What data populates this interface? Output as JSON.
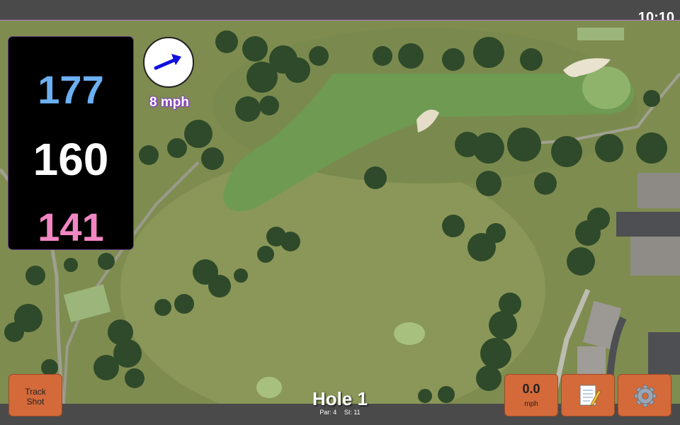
{
  "status": {
    "time": "10:10"
  },
  "distances": {
    "back": "177",
    "middle": "160",
    "front": "141"
  },
  "wind": {
    "speed_label": "8 mph",
    "direction": "east-northeast"
  },
  "buttons": {
    "track_shot": {
      "line1": "Track",
      "line2": "Shot"
    },
    "speed": {
      "value": "0.0",
      "unit": "mph"
    },
    "notes_icon": "notepad-icon",
    "settings_icon": "gear-icon"
  },
  "hole": {
    "title": "Hole 1",
    "par": "Par: 4",
    "si": "SI: 11"
  },
  "colors": {
    "back_distance": "#6bb0f2",
    "middle_distance": "#ffffff",
    "front_distance": "#f286c3",
    "button": "#d46a3a",
    "wind_arrow": "#1010e0"
  }
}
